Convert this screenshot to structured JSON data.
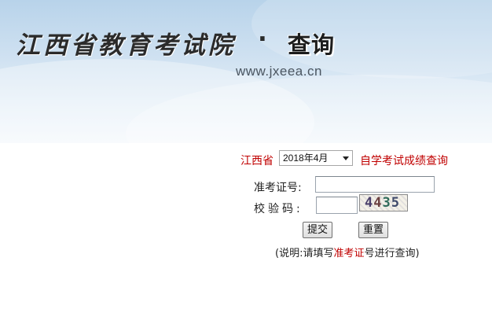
{
  "banner": {
    "title": "江西省教育考试院",
    "dot": "·",
    "query": "查询",
    "url": "www.jxeea.cn"
  },
  "form": {
    "province": "江西省",
    "exam_date": "2018年4月",
    "query_title": "自学考试成绩查询",
    "exam_id_label": "准考证号:",
    "code_label": "校验码:",
    "exam_id_value": "",
    "code_value": "",
    "captcha": [
      "4",
      "4",
      "3",
      "5"
    ],
    "submit_label": "提交",
    "reset_label": "重置"
  },
  "note": {
    "prefix": "(说明:请填写",
    "highlight": "准考证",
    "suffix": "号进行查询)"
  },
  "colors": {
    "accent": "#c00000",
    "banner_top": "#b8d3ea"
  }
}
